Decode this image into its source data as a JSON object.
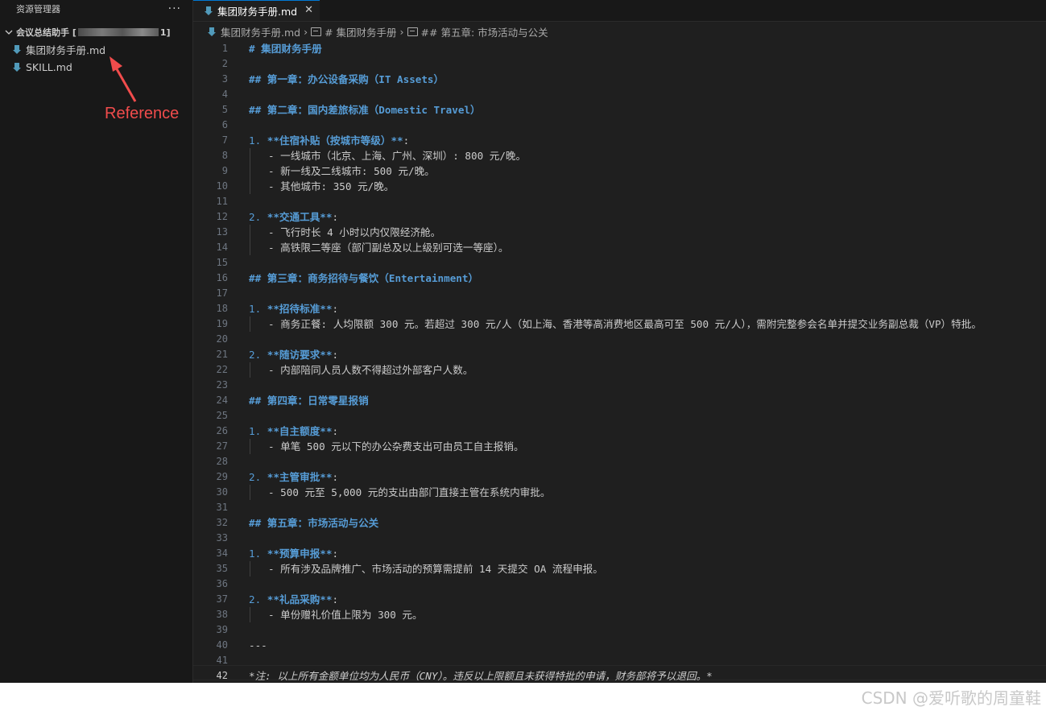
{
  "sidebar": {
    "title": "资源管理器",
    "more": "···",
    "folder_name": "会议总结助手 [",
    "folder_suffix": "1]",
    "files": [
      "集团财务手册.md",
      "SKILL.md"
    ]
  },
  "annotation": {
    "text": "Reference",
    "color": "#f14c4c"
  },
  "tab": {
    "label": "集团财务手册.md",
    "close": "✕"
  },
  "breadcrumb": {
    "file": "集团财务手册.md",
    "sym1": "# 集团财务手册",
    "sym2": "## 第五章: 市场活动与公关",
    "sep": "›"
  },
  "editor": {
    "active_line": 42,
    "lines": [
      {
        "n": "1",
        "t": "h",
        "text": "# 集团财务手册"
      },
      {
        "n": "2",
        "t": "",
        "text": ""
      },
      {
        "n": "3",
        "t": "h",
        "text": "## 第一章：办公设备采购（IT Assets）"
      },
      {
        "n": "4",
        "t": "",
        "text": ""
      },
      {
        "n": "5",
        "t": "h",
        "text": "## 第二章：国内差旅标准（Domestic Travel）"
      },
      {
        "n": "6",
        "t": "",
        "text": ""
      },
      {
        "n": "7",
        "t": "item",
        "num": "1.",
        "text": "**住宿补贴（按城市等级）**:"
      },
      {
        "n": "8",
        "t": "sub",
        "text": "- 一线城市（北京、上海、广州、深圳）: 800 元/晚。"
      },
      {
        "n": "9",
        "t": "sub",
        "text": "- 新一线及二线城市: 500 元/晚。"
      },
      {
        "n": "10",
        "t": "sub",
        "text": "- 其他城市: 350 元/晚。"
      },
      {
        "n": "11",
        "t": "",
        "text": ""
      },
      {
        "n": "12",
        "t": "item",
        "num": "2.",
        "text": "**交通工具**:"
      },
      {
        "n": "13",
        "t": "sub",
        "text": "- 飞行时长 4 小时以内仅限经济舱。"
      },
      {
        "n": "14",
        "t": "sub",
        "text": "- 高铁限二等座（部门副总及以上级别可选一等座）。"
      },
      {
        "n": "15",
        "t": "",
        "text": ""
      },
      {
        "n": "16",
        "t": "h",
        "text": "## 第三章：商务招待与餐饮（Entertainment）"
      },
      {
        "n": "17",
        "t": "",
        "text": ""
      },
      {
        "n": "18",
        "t": "item",
        "num": "1.",
        "text": "**招待标准**:"
      },
      {
        "n": "19",
        "t": "sub",
        "text": "- 商务正餐: 人均限额 300 元。若超过 300 元/人（如上海、香港等高消费地区最高可至 500 元/人），需附完整参会名单并提交业务副总裁（VP）特批。"
      },
      {
        "n": "20",
        "t": "",
        "text": ""
      },
      {
        "n": "21",
        "t": "item",
        "num": "2.",
        "text": "**随访要求**:"
      },
      {
        "n": "22",
        "t": "sub",
        "text": "- 内部陪同人员人数不得超过外部客户人数。"
      },
      {
        "n": "23",
        "t": "",
        "text": ""
      },
      {
        "n": "24",
        "t": "h",
        "text": "## 第四章：日常零星报销"
      },
      {
        "n": "25",
        "t": "",
        "text": ""
      },
      {
        "n": "26",
        "t": "item",
        "num": "1.",
        "text": "**自主额度**:"
      },
      {
        "n": "27",
        "t": "sub",
        "text": "- 单笔 500 元以下的办公杂费支出可由员工自主报销。"
      },
      {
        "n": "28",
        "t": "",
        "text": ""
      },
      {
        "n": "29",
        "t": "item",
        "num": "2.",
        "text": "**主管审批**:"
      },
      {
        "n": "30",
        "t": "sub",
        "text": "- 500 元至 5,000 元的支出由部门直接主管在系统内审批。"
      },
      {
        "n": "31",
        "t": "",
        "text": ""
      },
      {
        "n": "32",
        "t": "h",
        "text": "## 第五章：市场活动与公关"
      },
      {
        "n": "33",
        "t": "",
        "text": ""
      },
      {
        "n": "34",
        "t": "item",
        "num": "1.",
        "text": "**预算申报**:"
      },
      {
        "n": "35",
        "t": "sub",
        "text": "- 所有涉及品牌推广、市场活动的预算需提前 14 天提交 OA 流程申报。"
      },
      {
        "n": "36",
        "t": "",
        "text": ""
      },
      {
        "n": "37",
        "t": "item",
        "num": "2.",
        "text": "**礼品采购**:"
      },
      {
        "n": "38",
        "t": "sub",
        "text": "- 单份赠礼价值上限为 300 元。"
      },
      {
        "n": "39",
        "t": "",
        "text": ""
      },
      {
        "n": "40",
        "t": "plain",
        "text": "---"
      },
      {
        "n": "41",
        "t": "",
        "text": ""
      },
      {
        "n": "42",
        "t": "italic",
        "text": "*注: 以上所有金额单位均为人民币（CNY）。违反以上限额且未获得特批的申请，财务部将予以退回。*"
      }
    ]
  },
  "watermark": "CSDN @爱听歌的周童鞋",
  "colors": {
    "accent": "#0078d4",
    "heading": "#569cd6",
    "text": "#cccccc",
    "bg": "#1f1f1f"
  }
}
